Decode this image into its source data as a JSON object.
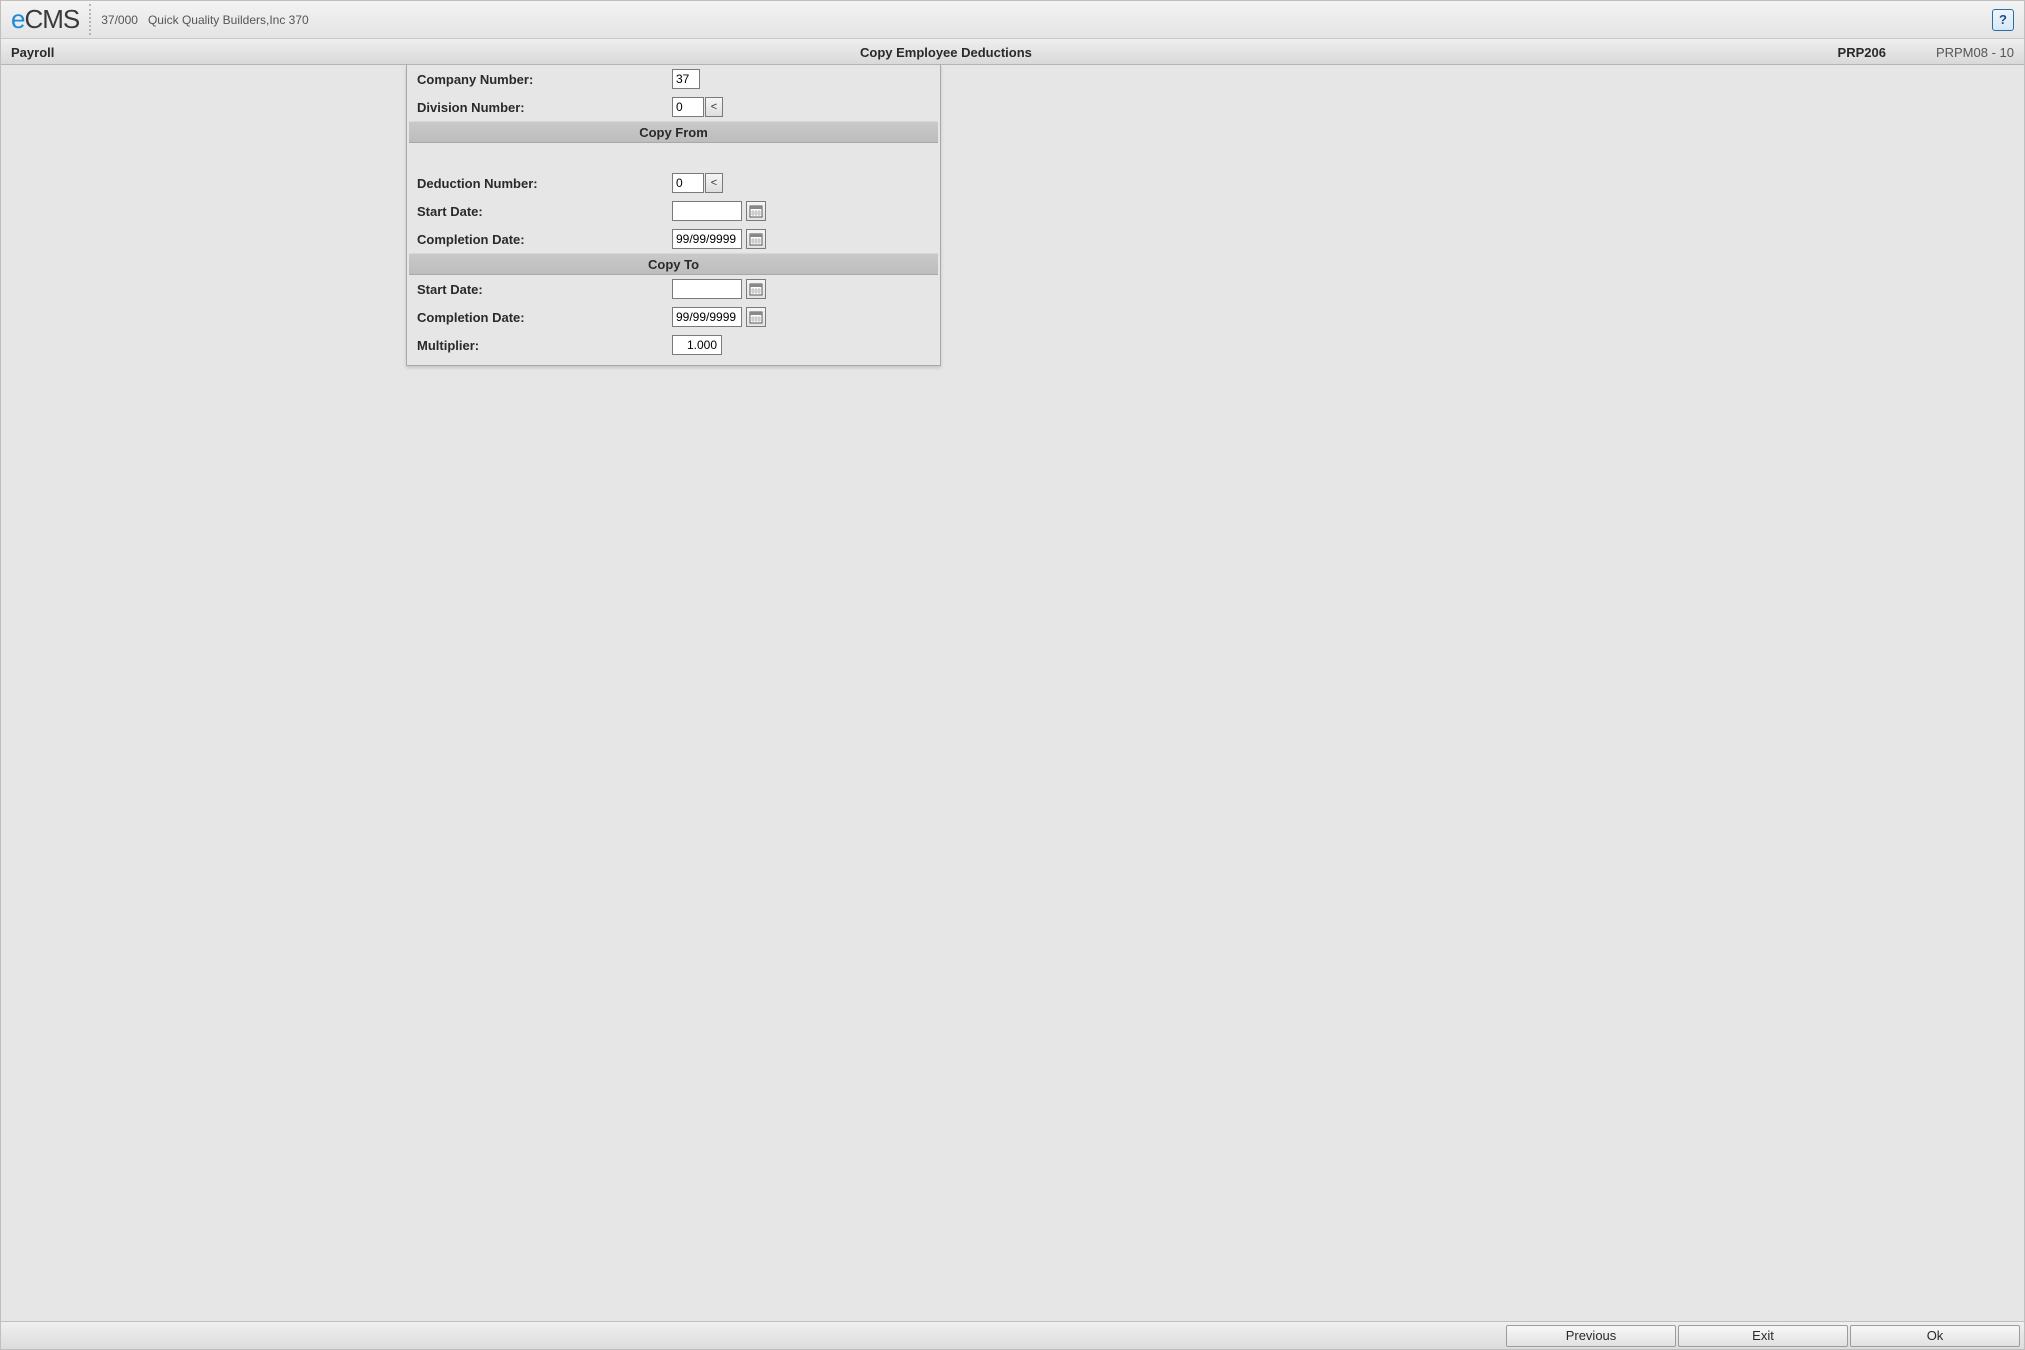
{
  "titlebar": {
    "logo_e": "e",
    "logo_cms": "CMS",
    "company_code": "37/000",
    "company_name": "Quick Quality Builders,Inc 370",
    "help_glyph": "?"
  },
  "subheader": {
    "module": "Payroll",
    "title": "Copy Employee Deductions",
    "program_code": "PRP206",
    "screen_code": "PRPM08 - 10"
  },
  "form": {
    "company_number": {
      "label": "Company Number:",
      "value": "37"
    },
    "division_number": {
      "label": "Division Number:",
      "value": "0",
      "lookup_glyph": "<"
    },
    "section_copy_from": "Copy From",
    "deduction_number": {
      "label": "Deduction Number:",
      "value": "0",
      "lookup_glyph": "<"
    },
    "from_start_date": {
      "label": "Start Date:",
      "value": ""
    },
    "from_completion_date": {
      "label": "Completion Date:",
      "value": "99/99/9999"
    },
    "section_copy_to": "Copy To",
    "to_start_date": {
      "label": "Start Date:",
      "value": ""
    },
    "to_completion_date": {
      "label": "Completion Date:",
      "value": "99/99/9999"
    },
    "multiplier": {
      "label": "Multiplier:",
      "value": "1.000"
    }
  },
  "footer": {
    "previous": "Previous",
    "exit": "Exit",
    "ok": "Ok"
  }
}
